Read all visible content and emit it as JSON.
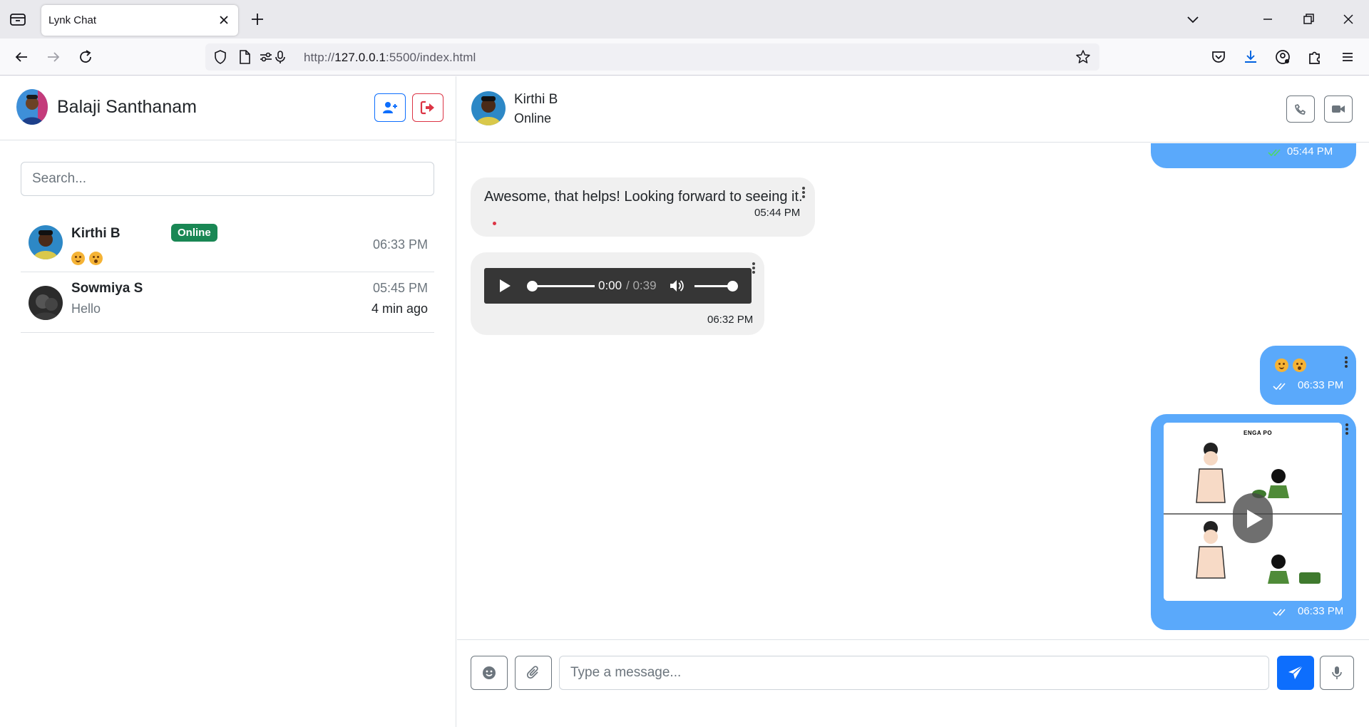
{
  "browser": {
    "tab_title": "Lynk Chat",
    "url_prefix": "http://",
    "url_host": "127.0.0.1",
    "url_rest": ":5500/index.html"
  },
  "sidebar": {
    "user_name": "Balaji Santhanam",
    "search_placeholder": "Search...",
    "contacts": [
      {
        "name": "Kirthi B",
        "badge": "Online",
        "time": "06:33 PM",
        "preview_emojis": [
          "smiling-face-icon",
          "kissing-face-icon"
        ]
      },
      {
        "name": "Sowmiya S",
        "time": "05:45 PM",
        "preview": "Hello",
        "ago": "4 min ago"
      }
    ]
  },
  "chat": {
    "contact_name": "Kirthi B",
    "contact_status": "Online",
    "messages": [
      {
        "direction": "out",
        "time": "05:44 PM",
        "ticks_color": "#4cd964"
      },
      {
        "direction": "in",
        "text": "Awesome, that helps! Looking forward to seeing it.",
        "time": "05:44 PM"
      },
      {
        "direction": "in",
        "type": "audio",
        "current": "0:00",
        "duration": "/ 0:39",
        "time": "06:32 PM"
      },
      {
        "direction": "out",
        "type": "emoji",
        "emojis": [
          "smiling-face-icon",
          "kissing-face-icon"
        ],
        "time": "06:33 PM"
      },
      {
        "direction": "out",
        "type": "video",
        "thumbnail_caption": "ENGA PO",
        "time": "06:33 PM"
      }
    ],
    "composer_placeholder": "Type a message..."
  },
  "colors": {
    "primary": "#0d6efd",
    "danger": "#dc3545",
    "online": "#198754",
    "outgoing_bubble": "#5aa9fb",
    "incoming_bubble": "#f0f0f0"
  }
}
